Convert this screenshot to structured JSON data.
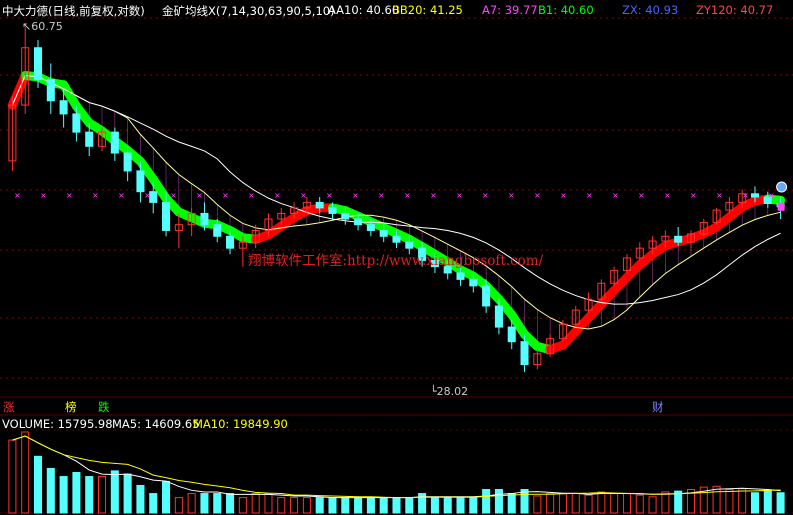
{
  "header": {
    "title": "中大力德(日线,前复权,对数)",
    "indicator": "金矿均线X(7,14,30,63,90,5,10)",
    "items": [
      {
        "label": "AA10: 40.60",
        "color": "#ffffff"
      },
      {
        "label": "BB20: 41.25",
        "color": "#ffff00"
      },
      {
        "label": "A7: 39.77",
        "color": "#ff44ff"
      },
      {
        "label": "B1: 40.60",
        "color": "#00ff00"
      },
      {
        "label": "ZX: 40.93",
        "color": "#4466ff"
      },
      {
        "label": "ZY120: 40.77",
        "color": "#ff4444"
      }
    ]
  },
  "volume_header": {
    "volume": "VOLUME: 15795.98",
    "ma5": "MA5: 14609.65",
    "ma10": "MA10: 19849.90"
  },
  "signals": [
    {
      "text": "涨",
      "color": "#ff3030"
    },
    {
      "text": "榜",
      "color": "#ffff00"
    },
    {
      "text": "跌",
      "color": "#00ff00"
    },
    {
      "text": "财",
      "color": "#8080ff"
    }
  ],
  "annotations": {
    "high": "60.75",
    "low": "28.02"
  },
  "watermark": "翔博软件工作室:http://www.xiangbosoft.com/",
  "colors": {
    "up": "#ff3030",
    "down": "#54ffff",
    "grid": "#8b0000",
    "ribbon_up": "#ff0000",
    "ribbon_down": "#00ff00"
  },
  "chart_data": {
    "type": "candlestick",
    "price_scale": "log",
    "price_range": [
      28.02,
      60.75
    ],
    "series": [
      {
        "name": "candles",
        "values": [
          [
            45.0,
            52.0,
            44.0,
            51.0
          ],
          [
            51.0,
            60.75,
            50.0,
            58.0
          ],
          [
            58.0,
            59.0,
            53.0,
            54.0
          ],
          [
            54.0,
            56.0,
            50.0,
            51.5
          ],
          [
            51.5,
            53.0,
            48.5,
            50.0
          ],
          [
            50.0,
            51.0,
            47.0,
            48.0
          ],
          [
            48.0,
            49.0,
            45.5,
            46.5
          ],
          [
            46.5,
            48.5,
            46.0,
            48.0
          ],
          [
            48.0,
            48.5,
            45.0,
            45.8
          ],
          [
            45.8,
            46.5,
            43.0,
            44.0
          ],
          [
            44.0,
            45.0,
            41.0,
            42.0
          ],
          [
            42.0,
            43.0,
            40.0,
            41.0
          ],
          [
            41.0,
            42.0,
            38.0,
            38.5
          ],
          [
            38.5,
            40.0,
            37.0,
            39.0
          ],
          [
            39.0,
            40.5,
            38.0,
            40.0
          ],
          [
            40.0,
            41.0,
            38.5,
            39.0
          ],
          [
            39.0,
            39.5,
            37.5,
            38.0
          ],
          [
            38.0,
            38.5,
            36.5,
            37.0
          ],
          [
            37.0,
            38.0,
            35.5,
            37.5
          ],
          [
            37.5,
            39.0,
            37.0,
            38.5
          ],
          [
            38.5,
            40.0,
            38.0,
            39.5
          ],
          [
            39.5,
            40.5,
            39.0,
            40.0
          ],
          [
            40.0,
            41.0,
            39.5,
            40.5
          ],
          [
            40.5,
            41.5,
            40.0,
            41.0
          ],
          [
            41.0,
            41.5,
            40.0,
            40.5
          ],
          [
            40.5,
            41.0,
            39.5,
            40.0
          ],
          [
            40.0,
            40.5,
            39.0,
            39.5
          ],
          [
            39.5,
            40.0,
            38.5,
            39.0
          ],
          [
            39.0,
            39.5,
            38.0,
            38.5
          ],
          [
            38.5,
            39.0,
            37.5,
            38.0
          ],
          [
            38.0,
            38.5,
            37.0,
            37.5
          ],
          [
            37.5,
            38.0,
            36.5,
            37.0
          ],
          [
            37.0,
            37.5,
            35.5,
            36.0
          ],
          [
            36.0,
            36.5,
            35.0,
            35.5
          ],
          [
            35.5,
            36.0,
            34.5,
            35.0
          ],
          [
            35.0,
            35.5,
            34.0,
            34.5
          ],
          [
            34.5,
            35.0,
            33.5,
            34.0
          ],
          [
            34.0,
            34.5,
            32.0,
            32.5
          ],
          [
            32.5,
            33.0,
            30.5,
            31.0
          ],
          [
            31.0,
            31.5,
            29.5,
            30.0
          ],
          [
            30.0,
            30.5,
            28.02,
            28.5
          ],
          [
            28.5,
            29.5,
            28.2,
            29.2
          ],
          [
            29.2,
            30.5,
            29.0,
            30.2
          ],
          [
            30.2,
            31.5,
            30.0,
            31.2
          ],
          [
            31.2,
            32.5,
            31.0,
            32.2
          ],
          [
            32.2,
            33.5,
            32.0,
            33.0
          ],
          [
            33.0,
            34.5,
            32.8,
            34.2
          ],
          [
            34.2,
            35.5,
            34.0,
            35.2
          ],
          [
            35.2,
            36.5,
            35.0,
            36.2
          ],
          [
            36.2,
            37.5,
            36.0,
            37.0
          ],
          [
            37.0,
            38.0,
            36.5,
            37.6
          ],
          [
            37.6,
            38.5,
            37.0,
            38.0
          ],
          [
            38.0,
            38.8,
            37.2,
            37.5
          ],
          [
            37.5,
            38.5,
            37.0,
            38.2
          ],
          [
            38.2,
            39.5,
            38.0,
            39.2
          ],
          [
            39.2,
            40.5,
            39.0,
            40.3
          ],
          [
            40.3,
            41.5,
            40.0,
            41.0
          ],
          [
            41.0,
            42.2,
            40.5,
            41.8
          ],
          [
            41.8,
            42.5,
            41.0,
            41.5
          ],
          [
            41.5,
            42.0,
            40.5,
            40.9
          ],
          [
            40.9,
            41.5,
            39.5,
            40.6
          ]
        ]
      }
    ]
  }
}
